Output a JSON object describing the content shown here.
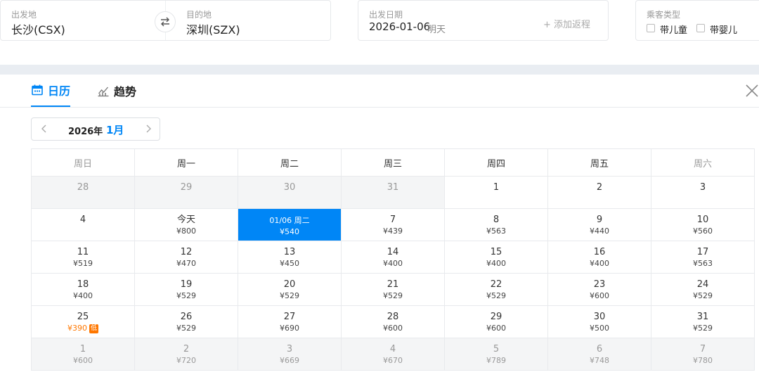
{
  "search": {
    "from": {
      "label": "出发地",
      "value": "长沙(CSX)"
    },
    "to": {
      "label": "目的地",
      "value": "深圳(SZX)"
    },
    "date": {
      "label": "出发日期",
      "value": "2026-01-06",
      "hint": "明天",
      "add_return": "+ 添加返程"
    },
    "passenger": {
      "label": "乘客类型",
      "options": [
        "带儿童",
        "带婴儿"
      ]
    }
  },
  "tabs": {
    "calendar": "日历",
    "trend": "趋势"
  },
  "month_nav": {
    "year": "2026年",
    "month": "1月"
  },
  "weekdays": [
    "周日",
    "周一",
    "周二",
    "周三",
    "周四",
    "周五",
    "周六"
  ],
  "weeks": [
    [
      {
        "day": "28",
        "price": "",
        "gray": true
      },
      {
        "day": "29",
        "price": "",
        "gray": true
      },
      {
        "day": "30",
        "price": "",
        "gray": true
      },
      {
        "day": "31",
        "price": "",
        "gray": true
      },
      {
        "day": "1",
        "price": ""
      },
      {
        "day": "2",
        "price": ""
      },
      {
        "day": "3",
        "price": ""
      }
    ],
    [
      {
        "day": "4",
        "price": ""
      },
      {
        "day": "今天",
        "price": "¥800"
      },
      {
        "day": "01/06 周二",
        "price": "¥540",
        "selected": true
      },
      {
        "day": "7",
        "price": "¥439"
      },
      {
        "day": "8",
        "price": "¥563"
      },
      {
        "day": "9",
        "price": "¥440"
      },
      {
        "day": "10",
        "price": "¥560"
      }
    ],
    [
      {
        "day": "11",
        "price": "¥519"
      },
      {
        "day": "12",
        "price": "¥470"
      },
      {
        "day": "13",
        "price": "¥450"
      },
      {
        "day": "14",
        "price": "¥400"
      },
      {
        "day": "15",
        "price": "¥400"
      },
      {
        "day": "16",
        "price": "¥400"
      },
      {
        "day": "17",
        "price": "¥563"
      }
    ],
    [
      {
        "day": "18",
        "price": "¥400"
      },
      {
        "day": "19",
        "price": "¥529"
      },
      {
        "day": "20",
        "price": "¥529"
      },
      {
        "day": "21",
        "price": "¥529"
      },
      {
        "day": "22",
        "price": "¥529"
      },
      {
        "day": "23",
        "price": "¥600"
      },
      {
        "day": "24",
        "price": "¥529"
      }
    ],
    [
      {
        "day": "25",
        "price": "¥390",
        "low": true,
        "tag": "低"
      },
      {
        "day": "26",
        "price": "¥529"
      },
      {
        "day": "27",
        "price": "¥690"
      },
      {
        "day": "28",
        "price": "¥600"
      },
      {
        "day": "29",
        "price": "¥600"
      },
      {
        "day": "30",
        "price": "¥500"
      },
      {
        "day": "31",
        "price": "¥529"
      }
    ],
    [
      {
        "day": "1",
        "price": "¥600",
        "gray": true
      },
      {
        "day": "2",
        "price": "¥720",
        "gray": true
      },
      {
        "day": "3",
        "price": "¥669",
        "gray": true
      },
      {
        "day": "4",
        "price": "¥670",
        "gray": true
      },
      {
        "day": "5",
        "price": "¥789",
        "gray": true
      },
      {
        "day": "6",
        "price": "¥748",
        "gray": true
      },
      {
        "day": "7",
        "price": "¥780",
        "gray": true
      }
    ]
  ],
  "colors": {
    "accent": "#0086f6",
    "low_price": "#ff7700"
  }
}
